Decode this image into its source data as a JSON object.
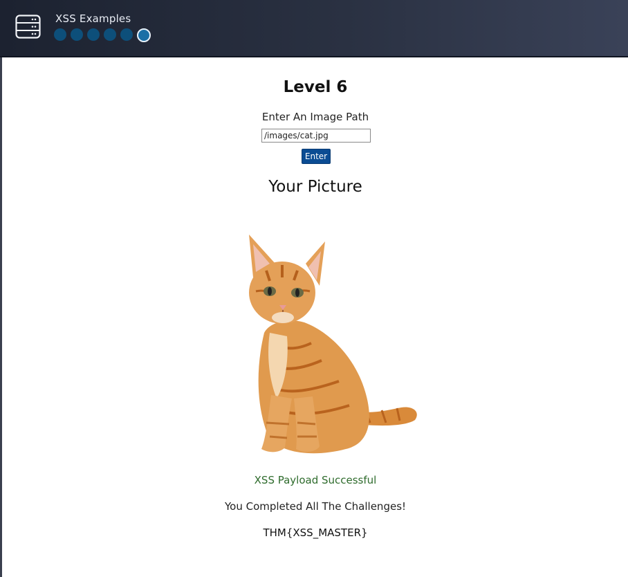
{
  "header": {
    "title": "XSS Examples",
    "icon": "server-rack-icon",
    "progress": {
      "total": 6,
      "current": 6
    }
  },
  "challenge": {
    "level_title": "Level 6",
    "path_label": "Enter An Image Path",
    "path_value": "/images/cat.jpg",
    "submit_label": "Enter",
    "picture_title": "Your Picture"
  },
  "result": {
    "success_text": "XSS Payload Successful",
    "completed_text": "You Completed All The Challenges!",
    "flag": "THM{XSS_MASTER}"
  },
  "colors": {
    "header_bg": "#2a3142",
    "dot_inactive": "#0d4f7a",
    "dot_active": "#1b6fa6",
    "button_bg": "#0b4c93",
    "success": "#2e6b2c"
  }
}
